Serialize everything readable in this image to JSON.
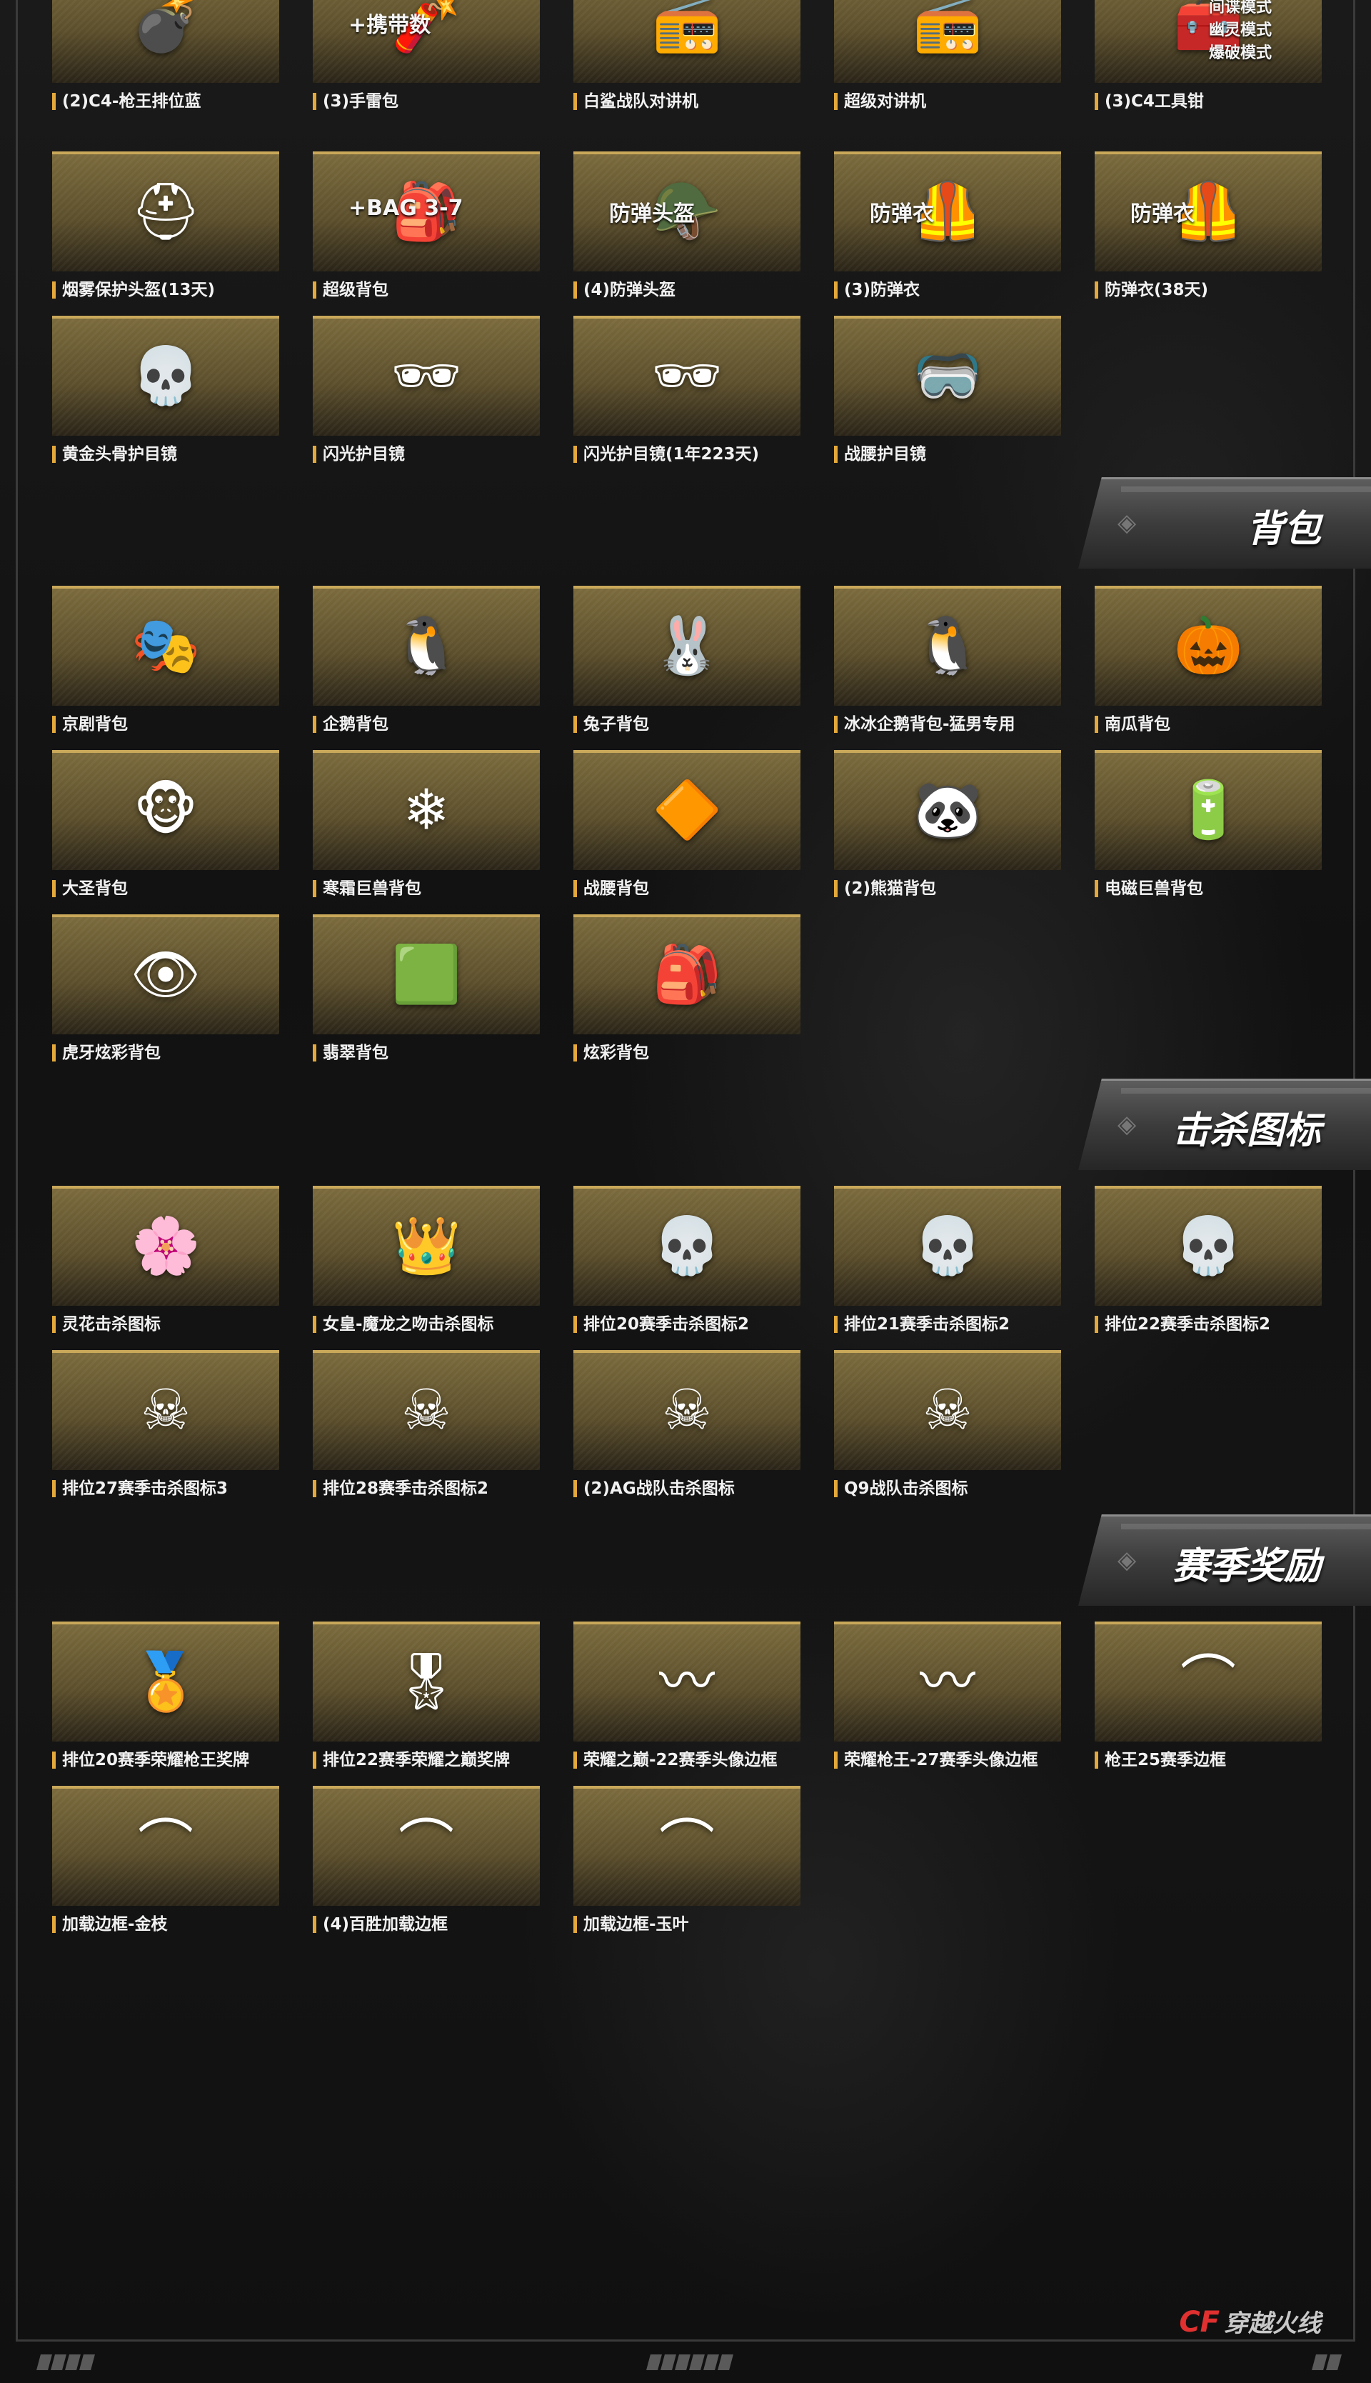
{
  "sections": [
    {
      "key": "backpack",
      "title": "背包"
    },
    {
      "key": "kill_icon",
      "title": "击杀图标"
    },
    {
      "key": "season",
      "title": "赛季奖励"
    }
  ],
  "items": [
    {
      "label": "(2)C4-枪王排位蓝",
      "icon": "c4-icon",
      "glyph": "💣"
    },
    {
      "label": "(3)手雷包",
      "icon": "grenade-pack-icon",
      "glyph": "🧨",
      "overlay": "+携带数"
    },
    {
      "label": "白鲨战队对讲机",
      "icon": "walkie-talkie-icon",
      "glyph": "📻"
    },
    {
      "label": "超级对讲机",
      "icon": "walkie-talkie-icon",
      "glyph": "📻"
    },
    {
      "label": "(3)C4工具钳",
      "icon": "c4-tool-icon",
      "glyph": "🧰",
      "overlay": "超级佣兵爆破\n间谍模式\n幽灵模式\n爆破模式"
    },
    {
      "label": "烟雾保护头盔(13天)",
      "icon": "helmet-icon",
      "glyph": "⛑"
    },
    {
      "label": "超级背包",
      "icon": "backpack-icon",
      "glyph": "🎒",
      "overlay": "+BAG 3-7"
    },
    {
      "label": "(4)防弹头盔",
      "icon": "helmet-icon",
      "glyph": "🪖",
      "overlay": "防弹头盔"
    },
    {
      "label": "(3)防弹衣",
      "icon": "vest-icon",
      "glyph": "🦺",
      "overlay": "防弹衣"
    },
    {
      "label": "防弹衣(38天)",
      "icon": "vest-icon",
      "glyph": "🦺",
      "overlay": "防弹衣"
    },
    {
      "label": "黄金头骨护目镜",
      "icon": "skull-goggles-icon",
      "glyph": "💀"
    },
    {
      "label": "闪光护目镜",
      "icon": "goggles-icon",
      "glyph": "🕶"
    },
    {
      "label": "闪光护目镜(1年223天)",
      "icon": "goggles-icon",
      "glyph": "🕶"
    },
    {
      "label": "战腰护目镜",
      "icon": "goggles-icon",
      "glyph": "🥽"
    },
    {
      "label": "京剧背包",
      "icon": "opera-backpack-icon",
      "glyph": "🎭"
    },
    {
      "label": "企鹅背包",
      "icon": "penguin-icon",
      "glyph": "🐧"
    },
    {
      "label": "兔子背包",
      "icon": "rabbit-icon",
      "glyph": "🐰"
    },
    {
      "label": "冰冰企鹅背包-猛男专用",
      "icon": "pink-penguin-icon",
      "glyph": "🐧"
    },
    {
      "label": "南瓜背包",
      "icon": "pumpkin-icon",
      "glyph": "🎃"
    },
    {
      "label": "大圣背包",
      "icon": "monkey-icon",
      "glyph": "🐵"
    },
    {
      "label": "寒霜巨兽背包",
      "icon": "frost-backpack-icon",
      "glyph": "❄"
    },
    {
      "label": "战腰背包",
      "icon": "mech-backpack-icon",
      "glyph": "🔶"
    },
    {
      "label": "(2)熊猫背包",
      "icon": "panda-icon",
      "glyph": "🐼"
    },
    {
      "label": "电磁巨兽背包",
      "icon": "electro-backpack-icon",
      "glyph": "🔋"
    },
    {
      "label": "虎牙炫彩背包",
      "icon": "tiger-backpack-icon",
      "glyph": "👁"
    },
    {
      "label": "翡翠背包",
      "icon": "jade-backpack-icon",
      "glyph": "🟩"
    },
    {
      "label": "炫彩背包",
      "icon": "dark-backpack-icon",
      "glyph": "🎒"
    },
    {
      "label": "灵花击杀图标",
      "icon": "flower-girl-icon",
      "glyph": "🌸"
    },
    {
      "label": "女皇-魔龙之吻击杀图标",
      "icon": "dragon-queen-icon",
      "glyph": "👑"
    },
    {
      "label": "排位20赛季击杀图标2",
      "icon": "skull-badge-icon",
      "glyph": "💀"
    },
    {
      "label": "排位21赛季击杀图标2",
      "icon": "skull-badge-icon",
      "glyph": "💀"
    },
    {
      "label": "排位22赛季击杀图标2",
      "icon": "skull-badge-icon",
      "glyph": "💀"
    },
    {
      "label": "排位27赛季击杀图标3",
      "icon": "skull-badge-icon",
      "glyph": "☠"
    },
    {
      "label": "排位28赛季击杀图标2",
      "icon": "skull-badge-icon",
      "glyph": "☠"
    },
    {
      "label": "(2)AG战队击杀图标",
      "icon": "star-skull-icon",
      "glyph": "☠"
    },
    {
      "label": "Q9战队击杀图标",
      "icon": "star-skull-icon",
      "glyph": "☠"
    },
    {
      "label": "排位20赛季荣耀枪王奖牌",
      "icon": "medal-icon",
      "glyph": "🏅"
    },
    {
      "label": "排位22赛季荣耀之巅奖牌",
      "icon": "medal-icon",
      "glyph": "🎖"
    },
    {
      "label": "荣耀之巅-22赛季头像边框",
      "icon": "wing-frame-icon",
      "glyph": "〰"
    },
    {
      "label": "荣耀枪王-27赛季头像边框",
      "icon": "wing-frame-icon",
      "glyph": "〰"
    },
    {
      "label": "枪王25赛季边框",
      "icon": "frame-icon",
      "glyph": "⌒"
    },
    {
      "label": "加载边框-金枝",
      "icon": "frame-icon",
      "glyph": "⌒"
    },
    {
      "label": "(4)百胜加载边框",
      "icon": "frame-icon",
      "glyph": "⌒"
    },
    {
      "label": "加载边框-玉叶",
      "icon": "frame-icon",
      "glyph": "⌒"
    }
  ],
  "brand": {
    "logo": "CF",
    "text": "穿越火线"
  }
}
